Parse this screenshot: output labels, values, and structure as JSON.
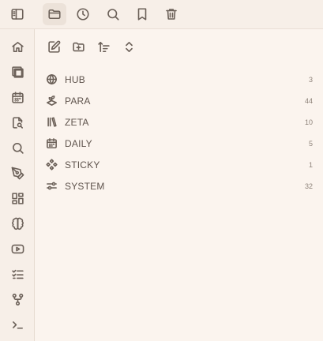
{
  "top_tabs": [
    {
      "icon": "sidebar-toggle-icon"
    },
    {
      "icon": "folder-open-icon",
      "active": true
    },
    {
      "icon": "clock-icon"
    },
    {
      "icon": "search-icon"
    },
    {
      "icon": "bookmark-icon"
    },
    {
      "icon": "trash-icon"
    }
  ],
  "ribbon": [
    {
      "icon": "home-icon"
    },
    {
      "icon": "layers-icon"
    },
    {
      "icon": "calendar-icon"
    },
    {
      "icon": "file-search-icon"
    },
    {
      "icon": "search-icon"
    },
    {
      "icon": "pen-tool-icon"
    },
    {
      "icon": "layout-grid-icon"
    },
    {
      "icon": "brain-icon"
    },
    {
      "icon": "play-video-icon"
    },
    {
      "icon": "checklist-icon"
    },
    {
      "icon": "git-fork-icon"
    },
    {
      "icon": "terminal-icon"
    }
  ],
  "toolbar": [
    {
      "icon": "new-note-icon"
    },
    {
      "icon": "new-folder-icon"
    },
    {
      "icon": "sort-icon"
    },
    {
      "icon": "expand-collapse-icon"
    }
  ],
  "folders": [
    {
      "name": "HUB",
      "count": "3",
      "icon": "globe-icon"
    },
    {
      "name": "PARA",
      "count": "44",
      "icon": "sprout-icon"
    },
    {
      "name": "ZETA",
      "count": "10",
      "icon": "library-icon"
    },
    {
      "name": "DAILY",
      "count": "5",
      "icon": "calendar-icon"
    },
    {
      "name": "STICKY",
      "count": "1",
      "icon": "diamonds-icon"
    },
    {
      "name": "SYSTEM",
      "count": "32",
      "icon": "sliders-icon"
    }
  ],
  "colors": {
    "background": "#fbf4ee",
    "panel": "#f7efe8",
    "active_tab": "#ece2d9",
    "icon": "#6b6058",
    "text": "#5f544d",
    "count": "#8d8279"
  }
}
